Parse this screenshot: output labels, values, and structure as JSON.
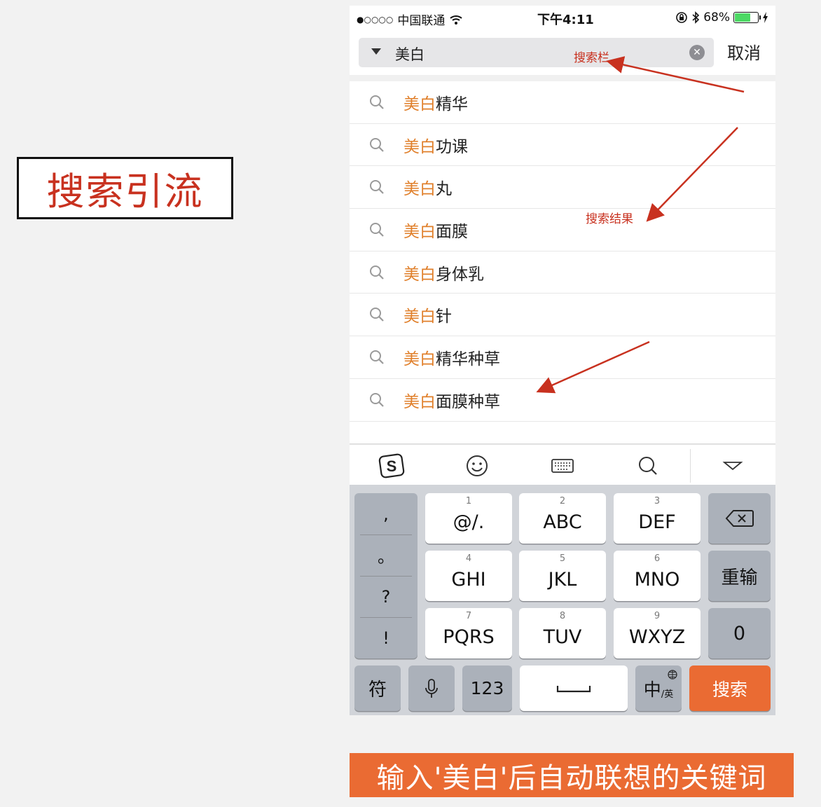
{
  "left_label": "搜索引流",
  "status_bar": {
    "carrier": "中国联通",
    "time": "下午4:11",
    "battery": "68%",
    "battery_level": 0.68
  },
  "search": {
    "value": "美白",
    "cancel_label": "取消",
    "annotation": "搜索栏"
  },
  "suggestions": [
    {
      "highlight": "美白",
      "rest": "精华"
    },
    {
      "highlight": "美白",
      "rest": "功课"
    },
    {
      "highlight": "美白",
      "rest": "丸"
    },
    {
      "highlight": "美白",
      "rest": "面膜"
    },
    {
      "highlight": "美白",
      "rest": "身体乳"
    },
    {
      "highlight": "美白",
      "rest": "针"
    },
    {
      "highlight": "美白",
      "rest": "精华种草"
    },
    {
      "highlight": "美白",
      "rest": "面膜种草"
    }
  ],
  "results_annotation": "搜索结果",
  "keyboard": {
    "punct": [
      ",",
      "。",
      "?",
      "!"
    ],
    "keys": [
      {
        "num": "1",
        "label": "@/."
      },
      {
        "num": "2",
        "label": "ABC"
      },
      {
        "num": "3",
        "label": "DEF"
      },
      {
        "num": "4",
        "label": "GHI"
      },
      {
        "num": "5",
        "label": "JKL"
      },
      {
        "num": "6",
        "label": "MNO"
      },
      {
        "num": "7",
        "label": "PQRS"
      },
      {
        "num": "8",
        "label": "TUV"
      },
      {
        "num": "9",
        "label": "WXYZ"
      }
    ],
    "retype": "重输",
    "zero": "0",
    "symbols": "符",
    "num_switch": "123",
    "lang": "中",
    "lang_sub": "/英",
    "search": "搜索"
  },
  "caption": "输入'美白'后自动联想的关键词",
  "colors": {
    "highlight": "#e07f2a",
    "annotation": "#c8311f",
    "caption_bg": "#ea6b33"
  }
}
